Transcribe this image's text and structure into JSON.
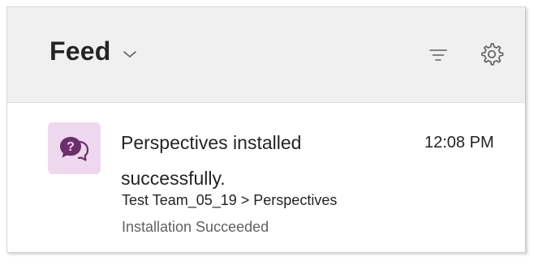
{
  "header": {
    "title": "Feed",
    "icons": {
      "dropdown": "chevron-down-icon",
      "filter": "filter-icon",
      "settings": "gear-icon"
    }
  },
  "notification": {
    "icon": "chat-question-icon",
    "title": "Perspectives installed successfully.",
    "time": "12:08 PM",
    "path": "Test Team_05_19 > Perspectives",
    "status": "Installation Succeeded"
  },
  "colors": {
    "header_bg": "#f0f0f0",
    "avatar_bg": "#eed8ee",
    "avatar_icon": "#6b2f6b",
    "text_primary": "#252423",
    "text_secondary": "#616161"
  }
}
